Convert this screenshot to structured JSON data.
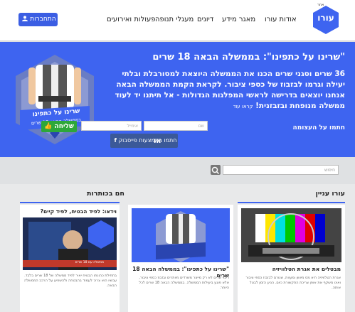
{
  "header": {
    "logo_text": "עורו",
    "logo_small": "אתר",
    "nav": [
      "אודות עורו",
      "מאגר מידע",
      "דיונים",
      "מעגלי תנופה",
      "פעולות ואירועים"
    ],
    "login_label": "התחברות"
  },
  "hero": {
    "title": "\"שרינו על כתפינו\": בממשלה הבאה 18 שרים",
    "body": "36 שרים וסגני שרים הכנו את הממשלה היוצאת למסורבלת ובלתי יעילה וגרמו לבזבוז של כספי ציבור. לקראת הקמת הממשלה הבאה אנחנו יוצאים בדרישה לראשי המפלגות הגדולות - אל תיתנו יד לעוד ממשלה מנופחת ובזבזנית!",
    "read_more": "קראו עוד",
    "join_label": "חתמו על העצומה",
    "name_placeholder": "שם",
    "email_placeholder": "אימייל",
    "send_label": "שליחה",
    "or_label": "או",
    "facebook_label": "חתמו באמצעות פייסבוק",
    "badge_line1": "שרינו על כתפינו",
    "badge_line2": "בממשלה הבאה 18 שרים"
  },
  "search": {
    "placeholder": "חיפוש"
  },
  "sections": {
    "right_title": "עורו עניין",
    "left_title": "חם בכותרות"
  },
  "cards": [
    {
      "title": "מבטלים את אגרת הטלוויזיה",
      "text": "אגרת הטלוויזיה היא מס מיושן ומעוות, שגורם לבזבוז כספי ציבור ואינו משקף את אופן צריכת התקשורת כיום. הגיע הזמן לבטל אותה."
    },
    {
      "title": "\"שרינו על כתפינו\": בממשלה הבאה 18 שרים",
      "text": "ריבוי שרים לא רק מייצר משרדים מיותרים ובזבוז כספי ציבור, אלא פוגע ביעילות הממשלה. בממשלה הבאה 18 שרים לכל היותר."
    },
    {
      "title": "וידאו: לפיד הבטיח, לפיד קיים?",
      "text": "בתחילת כהונתו הבטיח יאיר לפיד ממשלה של 18 שרים בלבד. עכשיו הוא צריך לעמוד בהבטחה ולהשפיע על הרכב הממשלה הבאה."
    },
    {
      "video_caption": "ממשלה עם 18 שרים"
    }
  ],
  "colors": {
    "brand_blue": "#3e64f0",
    "login_blue": "#3b5ee3",
    "send_green": "#2da73a",
    "facebook": "#3b5998"
  }
}
